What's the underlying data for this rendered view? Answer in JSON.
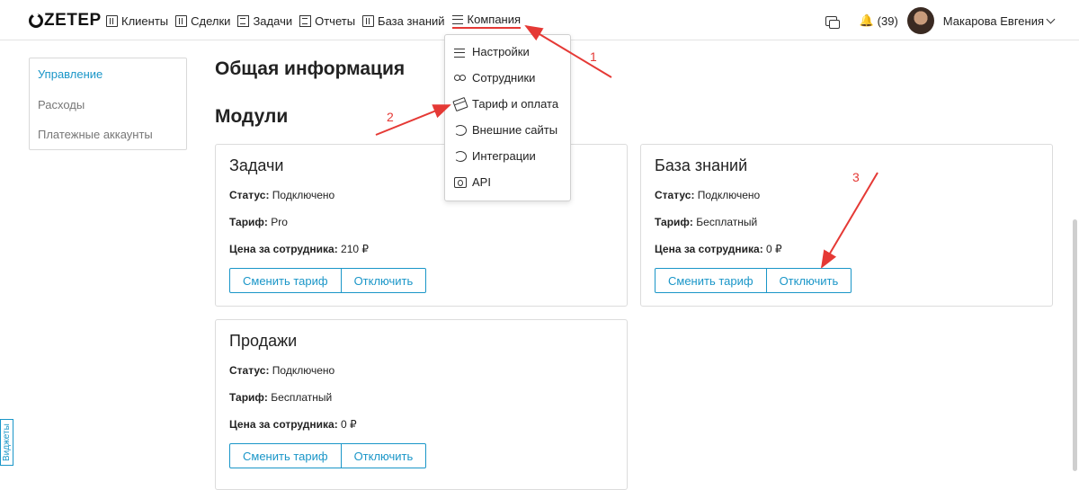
{
  "brand": {
    "name": "ZETEP"
  },
  "nav": {
    "items": [
      {
        "label": "Клиенты",
        "icon": "building-icon"
      },
      {
        "label": "Сделки",
        "icon": "building-icon"
      },
      {
        "label": "Задачи",
        "icon": "list-icon"
      },
      {
        "label": "Отчеты",
        "icon": "list-icon"
      },
      {
        "label": "База знаний",
        "icon": "building-icon"
      },
      {
        "label": "Компания",
        "icon": "menu-icon"
      }
    ]
  },
  "header": {
    "notifications_count": "(39)",
    "user_name": "Макарова Евгения"
  },
  "dropdown": {
    "items": [
      {
        "label": "Настройки",
        "icon": "menu-icon"
      },
      {
        "label": "Сотрудники",
        "icon": "people-icon"
      },
      {
        "label": "Тариф и оплата",
        "icon": "card-icon"
      },
      {
        "label": "Внешние сайты",
        "icon": "sync-icon"
      },
      {
        "label": "Интеграции",
        "icon": "sync-icon"
      },
      {
        "label": "API",
        "icon": "api-icon"
      }
    ]
  },
  "sidebar": {
    "items": [
      {
        "label": "Управление"
      },
      {
        "label": "Расходы"
      },
      {
        "label": "Платежные аккаунты"
      }
    ]
  },
  "main": {
    "title": "Общая информация",
    "section_title": "Модули",
    "status_label": "Статус:",
    "tariff_label": "Тариф:",
    "price_label": "Цена за сотрудника:",
    "change_tariff_label": "Сменить тариф",
    "disable_label": "Отключить",
    "modules": [
      {
        "name": "Задачи",
        "status": "Подключено",
        "tariff": "Pro",
        "price": "210 ₽"
      },
      {
        "name": "База знаний",
        "status": "Подключено",
        "tariff": "Бесплатный",
        "price": "0 ₽"
      },
      {
        "name": "Продажи",
        "status": "Подключено",
        "tariff": "Бесплатный",
        "price": "0 ₽"
      }
    ]
  },
  "widgets_label": "Виджеты",
  "annotations": {
    "marker_1": "1",
    "marker_2": "2",
    "marker_3": "3"
  },
  "colors": {
    "accent": "#1a96c8",
    "annotation": "#e53935"
  }
}
